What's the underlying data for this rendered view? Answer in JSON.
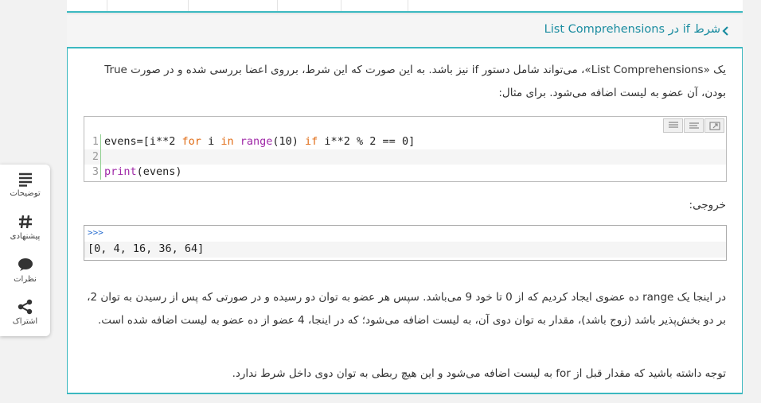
{
  "section": {
    "title": "شرط if در List Comprehensions"
  },
  "content": {
    "para1": "یک «List Comprehensions»، می‌تواند شامل دستور if نیز باشد. به این صورت که این شرط، برروی اعضا بررسی شده و در صورت True بودن، آن عضو به لیست اضافه می‌شود. برای مثال:",
    "code_lines": [
      {
        "num": "1",
        "text": "evens=[i**2 for i in range(10) if i**2 % 2 == 0]"
      },
      {
        "num": "2",
        "text": ""
      },
      {
        "num": "3",
        "text": "print(evens)"
      }
    ],
    "output_label": "خروجی:",
    "output_prompt": ">>>",
    "output_value": "[0, 4, 16, 36, 64]",
    "para2": "در اینجا یک range ده عضوی ایجاد کردیم که از 0 تا خود 9 می‌باشد. سپس هر عضو به توان دو رسیده و در صورتی که پس از رسیدن به توان 2، بر دو بخش‌پذیر باشد (زوج باشد)، مقدار به توان دوی آن، به لیست اضافه می‌شود؛ که در اینجا، 4 عضو از ده عضو به لیست اضافه شده است.",
    "para3": "توجه داشته باشید که مقدار قبل از for به لیست اضافه می‌شود و این هیچ ربطی به توان دوی داخل شرط ندارد."
  },
  "sidebar": {
    "items": [
      {
        "label": "توضیحات",
        "icon": "list-icon"
      },
      {
        "label": "پیشنهادی",
        "icon": "hashtag-icon"
      },
      {
        "label": "نظرات",
        "icon": "comment-icon"
      },
      {
        "label": "اشتراک",
        "icon": "share-icon"
      }
    ]
  },
  "colors": {
    "accent": "#3bb8c0",
    "title": "#1a8ca0"
  }
}
